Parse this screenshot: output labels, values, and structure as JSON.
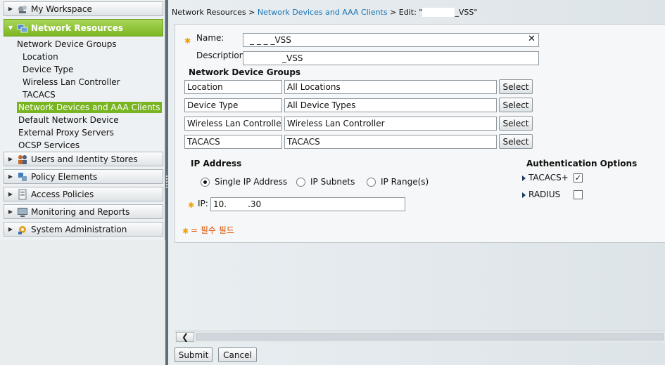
{
  "nav": {
    "drawers": {
      "my_workspace": "My Workspace",
      "network_resources": "Network Resources",
      "users_identity": "Users and Identity Stores",
      "policy_elements": "Policy Elements",
      "access_policies": "Access Policies",
      "monitoring_reports": "Monitoring and Reports",
      "system_admin": "System Administration"
    },
    "network_resources_items": {
      "ndg": "Network Device Groups",
      "location": "Location",
      "device_type": "Device Type",
      "wlc": "Wireless Lan Controller",
      "tacacs": "TACACS",
      "devices_clients": "Network Devices and AAA Clients",
      "default_device": "Default Network Device",
      "external_proxy": "External Proxy Servers",
      "ocsp": "OCSP Services"
    },
    "active_color": "#7cb623"
  },
  "breadcrumb": {
    "part1": "Network Resources >",
    "part2": "Network Devices and AAA Clients",
    "part3": "> Edit: \"",
    "part4": "_VSS\""
  },
  "form": {
    "name_label": "Name:",
    "name_value_suffix": "_ _ _ _VSS",
    "name_clear": "✕",
    "description_label": "Description:",
    "description_value_suffix": "_VSS",
    "ndg_heading": "Network Device Groups",
    "ndg_rows": [
      {
        "name": "Location",
        "value": "All Locations",
        "button": "Select"
      },
      {
        "name": "Device Type",
        "value": "All Device Types",
        "button": "Select"
      },
      {
        "name": "Wireless Lan Controller",
        "value": "Wireless Lan Controller",
        "button": "Select"
      },
      {
        "name": "TACACS",
        "value": "TACACS",
        "button": "Select"
      }
    ],
    "ip_heading": "IP Address",
    "ip_options": {
      "single": "Single IP Address",
      "subnets": "IP Subnets",
      "range": "IP Range(s)"
    },
    "ip_selected": "single",
    "ip_label": "IP:",
    "ip_value_start": "10.",
    "ip_value_end": ".30",
    "auth_heading": "Authentication Options",
    "auth_options": {
      "tacacs": {
        "label": "TACACS+",
        "checked": true,
        "mark": "✓"
      },
      "radius": {
        "label": "RADIUS",
        "checked": false,
        "mark": ""
      }
    },
    "required_note": "= 필수 필드",
    "required_color": "#e05000"
  },
  "footer": {
    "submit": "Submit",
    "cancel": "Cancel"
  }
}
